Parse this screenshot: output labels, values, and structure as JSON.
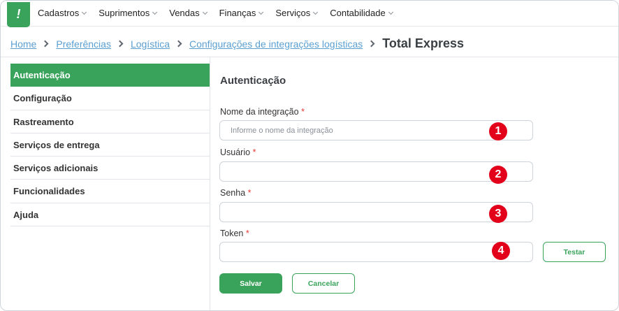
{
  "nav": {
    "logo_glyph": "!",
    "items": [
      {
        "label": "Cadastros"
      },
      {
        "label": "Suprimentos"
      },
      {
        "label": "Vendas"
      },
      {
        "label": "Finanças"
      },
      {
        "label": "Serviços"
      },
      {
        "label": "Contabilidade"
      }
    ]
  },
  "breadcrumb": {
    "links": [
      "Home",
      "Preferências",
      "Logística",
      "Configurações de integrações logísticas"
    ],
    "current": "Total Express"
  },
  "sidebar": {
    "items": [
      {
        "label": "Autenticação",
        "active": true
      },
      {
        "label": "Configuração"
      },
      {
        "label": "Rastreamento"
      },
      {
        "label": "Serviços de entrega"
      },
      {
        "label": "Serviços adicionais"
      },
      {
        "label": "Funcionalidades"
      },
      {
        "label": "Ajuda"
      }
    ]
  },
  "form": {
    "title": "Autenticação",
    "required_mark": "*",
    "fields": [
      {
        "label": "Nome da integração",
        "placeholder": "Informe o nome da integração",
        "value": "",
        "badge": "1"
      },
      {
        "label": "Usuário",
        "placeholder": "",
        "value": "",
        "badge": "2"
      },
      {
        "label": "Senha",
        "placeholder": "",
        "value": "",
        "badge": "3"
      },
      {
        "label": "Token",
        "placeholder": "",
        "value": "",
        "badge": "4"
      }
    ],
    "test_button": "Testar",
    "save_button": "Salvar",
    "cancel_button": "Cancelar"
  },
  "colors": {
    "accent": "#3aa35b",
    "link": "#5b9fd1",
    "badge": "#e3001b",
    "required": "#e53935"
  }
}
